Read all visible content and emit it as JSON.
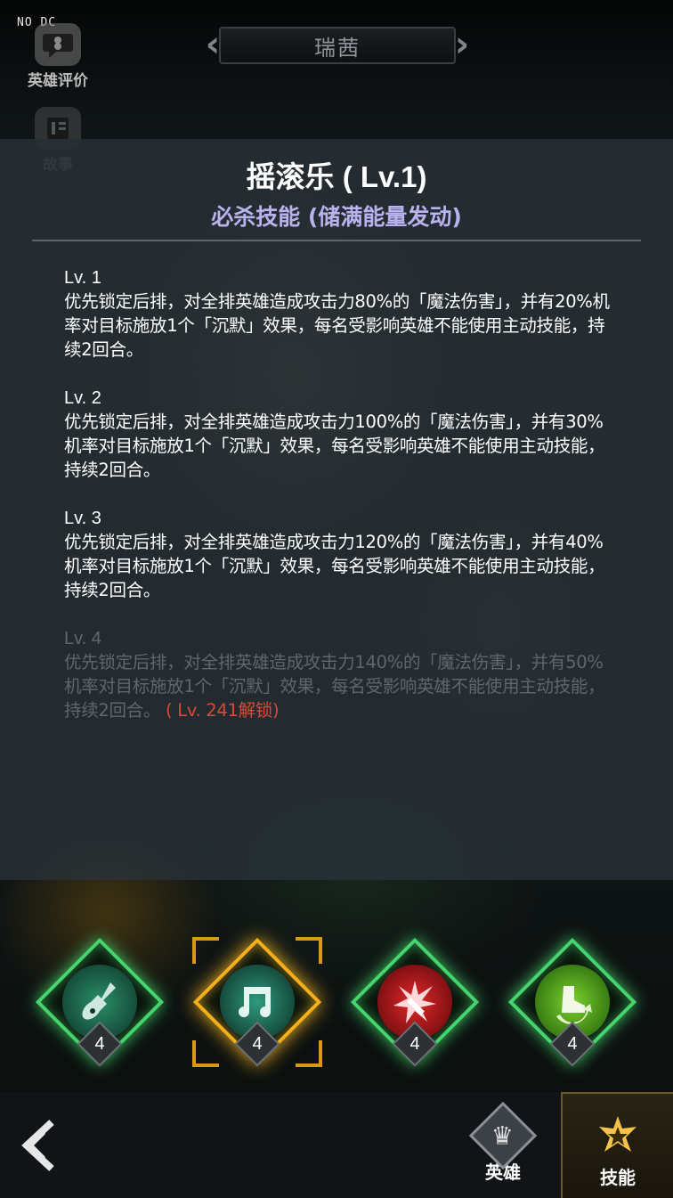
{
  "debug": {
    "tag": "NO DC"
  },
  "side": {
    "eval_label": "英雄评价",
    "story_label": "故事"
  },
  "hero": {
    "name": "瑞茜"
  },
  "skill": {
    "title": "摇滚乐 ( Lv.1)",
    "subtitle": "必杀技能 (储满能量发动)",
    "levels": [
      {
        "label": "Lv. 1",
        "text": "优先锁定后排，对全排英雄造成攻击力80%的「魔法伤害」，并有20%机率对目标施放1个「沉默」效果，每名受影响英雄不能使用主动技能，持续2回合。",
        "locked": false
      },
      {
        "label": "Lv. 2",
        "text": "优先锁定后排，对全排英雄造成攻击力100%的「魔法伤害」，并有30%机率对目标施放1个「沉默」效果，每名受影响英雄不能使用主动技能，持续2回合。",
        "locked": false
      },
      {
        "label": "Lv. 3",
        "text": "优先锁定后排，对全排英雄造成攻击力120%的「魔法伤害」，并有40%机率对目标施放1个「沉默」效果，每名受影响英雄不能使用主动技能，持续2回合。",
        "locked": false
      },
      {
        "label": "Lv. 4",
        "text": "优先锁定后排，对全排英雄造成攻击力140%的「魔法伤害」，并有50%机率对目标施放1个「沉默」效果，每名受影响英雄不能使用主动技能，持续2回合。",
        "locked": true,
        "unlock_note": "( Lv. 241解锁)"
      }
    ]
  },
  "skill_icons": [
    {
      "icon": "guitar-icon",
      "level": "4",
      "selected": false,
      "color": "#1f7a5a"
    },
    {
      "icon": "music-note-icon",
      "level": "4",
      "selected": true,
      "color": "#1f6a5a"
    },
    {
      "icon": "burst-dagger-icon",
      "level": "4",
      "selected": false,
      "color": "#c3141b"
    },
    {
      "icon": "boot-arrow-icon",
      "level": "4",
      "selected": false,
      "color": "#3c9a1a"
    }
  ],
  "nav": {
    "hero_label": "英雄",
    "skill_label": "技能"
  },
  "colors": {
    "accent_green": "#46d46e",
    "accent_gold": "#f5b01c",
    "subtitle": "#b9b2ee",
    "unlock_red": "#d84a36"
  }
}
